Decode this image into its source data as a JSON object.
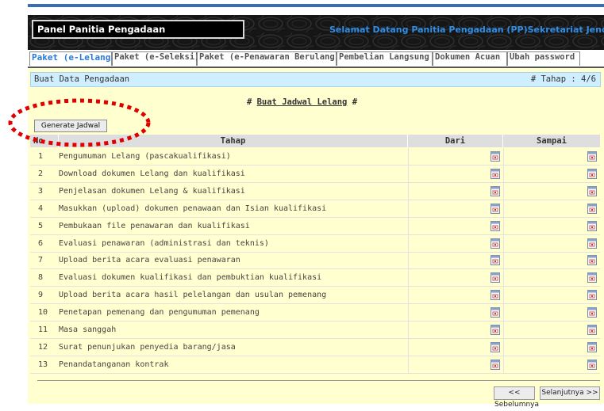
{
  "header": {
    "panel_title": "Panel Panitia Pengadaan",
    "welcome": "Selamat Datang Panitia Pengadaan (PP)Sekretariat Jendera"
  },
  "tabs": [
    {
      "label": "Paket (e-Lelang)",
      "active": true
    },
    {
      "label": "Paket (e-Seleksi)",
      "active": false
    },
    {
      "label": "Paket (e-Penawaran Berulang)",
      "active": false
    },
    {
      "label": "Pembelian Langsung",
      "active": false
    },
    {
      "label": "Dokumen Acuan",
      "active": false
    },
    {
      "label": "Ubah password",
      "active": false
    }
  ],
  "bar": {
    "left": "Buat Data Pengadaan",
    "right": "# Tahap : 4/6"
  },
  "section": {
    "prefix": "# ",
    "title": "Buat Jadwal Lelang",
    "suffix": " #"
  },
  "generate_button": "Generate Jadwal",
  "table": {
    "headers": {
      "no": "No",
      "tahap": "Tahap",
      "dari": "Dari",
      "sampai": "Sampai"
    },
    "rows": [
      {
        "no": "1",
        "tahap": "Pengumuman Lelang (pascakualifikasi)"
      },
      {
        "no": "2",
        "tahap": "Download dokumen Lelang dan kualifikasi"
      },
      {
        "no": "3",
        "tahap": "Penjelasan dokumen Lelang & kualifikasi"
      },
      {
        "no": "4",
        "tahap": "Masukkan (upload) dokumen penawaan dan Isian kualifikasi"
      },
      {
        "no": "5",
        "tahap": "Pembukaan file penawaran dan kualifikasi"
      },
      {
        "no": "6",
        "tahap": "Evaluasi penawaran (administrasi dan teknis)"
      },
      {
        "no": "7",
        "tahap": "Upload berita acara evaluasi penawaran"
      },
      {
        "no": "8",
        "tahap": "Evaluasi dokumen kualifikasi dan pembuktian kualifikasi"
      },
      {
        "no": "9",
        "tahap": "Upload berita acara hasil pelelangan dan usulan pemenang"
      },
      {
        "no": "10",
        "tahap": "Penetapan pemenang dan pengumuman pemenang"
      },
      {
        "no": "11",
        "tahap": "Masa sanggah"
      },
      {
        "no": "12",
        "tahap": "Surat penunjukan penyedia barang/jasa"
      },
      {
        "no": "13",
        "tahap": "Penandatanganan kontrak"
      }
    ]
  },
  "nav": {
    "prev": "<< Sebelumnya",
    "next": "Selanjutnya >>"
  },
  "colors": {
    "accent": "#2a7ad4",
    "welcome": "#2f8ee8",
    "content_bg": "#ffffcf",
    "bar_bg": "#cfeeff",
    "highlight": "#e00000"
  },
  "icons": [
    "calendar-icon"
  ]
}
